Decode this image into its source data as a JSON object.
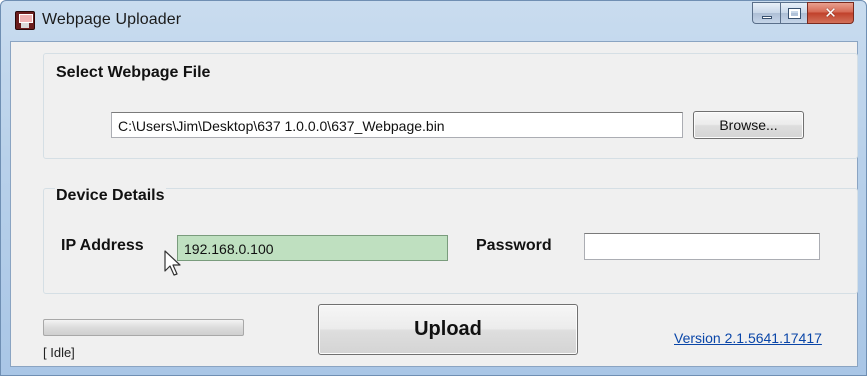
{
  "window": {
    "title": "Webpage Uploader",
    "icon": "app-floppy-icon"
  },
  "caption_buttons": {
    "minimize_icon": "minimize-icon",
    "maximize_icon": "maximize-icon",
    "close_glyph": "✕"
  },
  "file_group": {
    "title": "Select Webpage File",
    "file_path": "C:\\Users\\Jim\\Desktop\\637 1.0.0.0\\637_Webpage.bin",
    "browse_label": "Browse..."
  },
  "device_group": {
    "title": "Device Details",
    "ip_label": "IP Address",
    "ip_value": "192.168.0.100",
    "password_label": "Password",
    "password_value": ""
  },
  "footer": {
    "upload_label": "Upload",
    "status": "[ Idle]",
    "progress_fraction": 0,
    "version_link": "Version 2.1.5641.17417"
  },
  "colors": {
    "ip_field_bg": "#bfe0c0",
    "link": "#0a46a8",
    "close_button": "#c0412b"
  }
}
